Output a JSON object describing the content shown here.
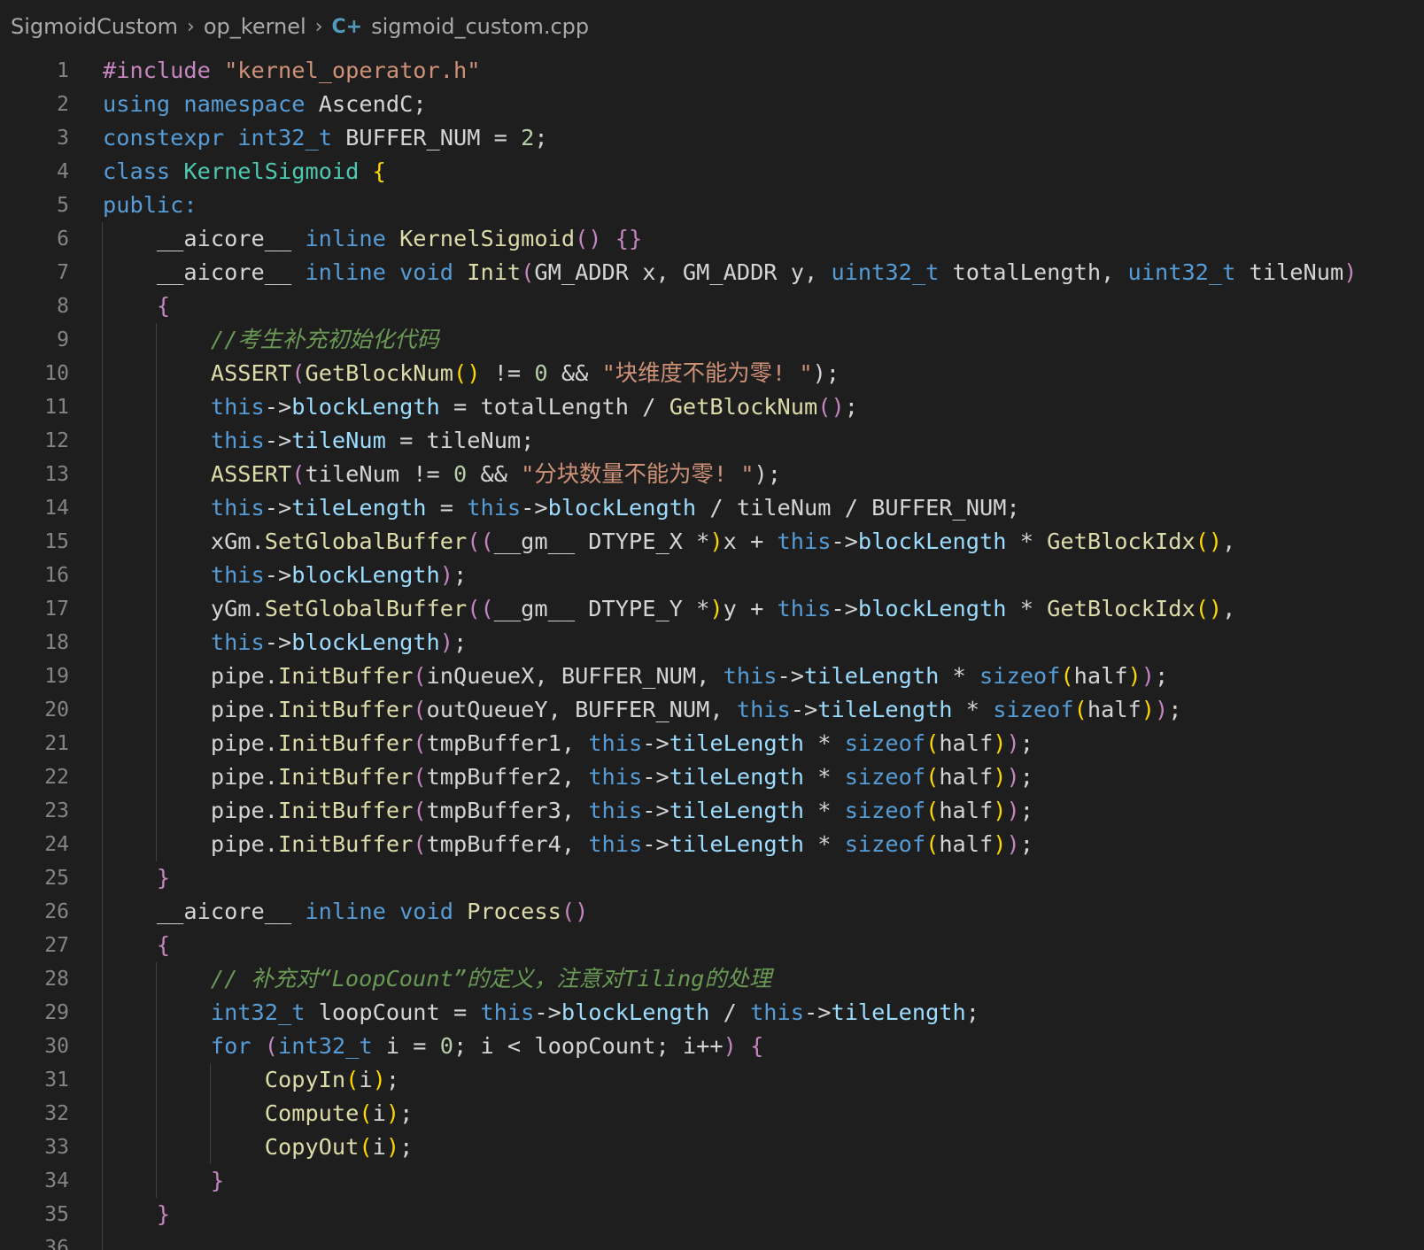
{
  "breadcrumb": {
    "items": [
      "SigmoidCustom",
      "op_kernel",
      "sigmoid_custom.cpp"
    ],
    "file_icon": "cpp-file-icon"
  },
  "colors": {
    "background": "#1e1e1e",
    "text": "#d4d4d4",
    "line_number": "#858585",
    "keyword": "#569cd6",
    "type": "#4ec9b0",
    "string": "#ce9178",
    "function": "#dcdcaa",
    "comment": "#6a9955",
    "number": "#b5cea8",
    "macro": "#c586c0",
    "member": "#9cdcfe"
  },
  "code_lines": [
    [
      [
        "#include ",
        "c"
      ],
      [
        "\"kernel_operator.h\"",
        "s"
      ]
    ],
    [
      [
        "using ",
        "k"
      ],
      [
        "namespace ",
        "k"
      ],
      [
        "AscendC;",
        "d"
      ]
    ],
    [
      [
        "constexpr ",
        "k"
      ],
      [
        "int32_t ",
        "k"
      ],
      [
        "BUFFER_NUM = ",
        "d"
      ],
      [
        "2",
        "n"
      ],
      [
        ";",
        "d"
      ]
    ],
    [
      [
        "class ",
        "k"
      ],
      [
        "KernelSigmoid ",
        "t"
      ],
      [
        "{",
        "y"
      ]
    ],
    [
      [
        "public:",
        "k"
      ]
    ],
    [
      [
        "    ",
        "d"
      ],
      [
        "__aicore__ ",
        "d"
      ],
      [
        "inline ",
        "k"
      ],
      [
        "KernelSigmoid",
        "f"
      ],
      [
        "() ",
        "p"
      ],
      [
        "{}",
        "p"
      ]
    ],
    [
      [
        "    ",
        "d"
      ],
      [
        "__aicore__ ",
        "d"
      ],
      [
        "inline ",
        "k"
      ],
      [
        "void ",
        "k"
      ],
      [
        "Init",
        "f"
      ],
      [
        "(",
        "p"
      ],
      [
        "GM_ADDR x, GM_ADDR y, ",
        "d"
      ],
      [
        "uint32_t ",
        "k"
      ],
      [
        "totalLength, ",
        "d"
      ],
      [
        "uint32_t ",
        "k"
      ],
      [
        "tileNum",
        "d"
      ],
      [
        ")",
        "p"
      ]
    ],
    [
      [
        "    ",
        "d"
      ],
      [
        "{",
        "p"
      ]
    ],
    [
      [
        "        ",
        "d"
      ],
      [
        "//考生补充初始化代码",
        "m"
      ]
    ],
    [
      [
        "        ",
        "d"
      ],
      [
        "ASSERT",
        "f"
      ],
      [
        "(",
        "p"
      ],
      [
        "GetBlockNum",
        "f"
      ],
      [
        "() ",
        "y"
      ],
      [
        "!= ",
        "d"
      ],
      [
        "0 ",
        "n"
      ],
      [
        "&& ",
        "d"
      ],
      [
        "\"块维度不能为零! \"",
        "s"
      ],
      [
        ");",
        "d"
      ]
    ],
    [
      [
        "        ",
        "d"
      ],
      [
        "this",
        "k"
      ],
      [
        "->",
        "d"
      ],
      [
        "blockLength ",
        "b"
      ],
      [
        "= totalLength / ",
        "d"
      ],
      [
        "GetBlockNum",
        "f"
      ],
      [
        "()",
        "p"
      ],
      [
        ";",
        "d"
      ]
    ],
    [
      [
        "        ",
        "d"
      ],
      [
        "this",
        "k"
      ],
      [
        "->",
        "d"
      ],
      [
        "tileNum ",
        "b"
      ],
      [
        "= tileNum;",
        "d"
      ]
    ],
    [
      [
        "        ",
        "d"
      ],
      [
        "ASSERT",
        "f"
      ],
      [
        "(",
        "p"
      ],
      [
        "tileNum != ",
        "d"
      ],
      [
        "0 ",
        "n"
      ],
      [
        "&& ",
        "d"
      ],
      [
        "\"分块数量不能为零! \"",
        "s"
      ],
      [
        ");",
        "d"
      ]
    ],
    [
      [
        "        ",
        "d"
      ],
      [
        "this",
        "k"
      ],
      [
        "->",
        "d"
      ],
      [
        "tileLength ",
        "b"
      ],
      [
        "= ",
        "d"
      ],
      [
        "this",
        "k"
      ],
      [
        "->",
        "d"
      ],
      [
        "blockLength ",
        "b"
      ],
      [
        "/ tileNum / BUFFER_NUM;",
        "d"
      ]
    ],
    [
      [
        "        ",
        "d"
      ],
      [
        "xGm.",
        "d"
      ],
      [
        "SetGlobalBuffer",
        "f"
      ],
      [
        "((",
        "p"
      ],
      [
        "__gm__ DTYPE_X *",
        "d"
      ],
      [
        ")",
        "y"
      ],
      [
        "x + ",
        "d"
      ],
      [
        "this",
        "k"
      ],
      [
        "->",
        "d"
      ],
      [
        "blockLength ",
        "b"
      ],
      [
        "* ",
        "d"
      ],
      [
        "GetBlockIdx",
        "f"
      ],
      [
        "()",
        "y"
      ],
      [
        ",",
        "d"
      ]
    ],
    [
      [
        "        ",
        "d"
      ],
      [
        "this",
        "k"
      ],
      [
        "->",
        "d"
      ],
      [
        "blockLength",
        "b"
      ],
      [
        ")",
        "p"
      ],
      [
        ";",
        "d"
      ]
    ],
    [
      [
        "        ",
        "d"
      ],
      [
        "yGm.",
        "d"
      ],
      [
        "SetGlobalBuffer",
        "f"
      ],
      [
        "((",
        "p"
      ],
      [
        "__gm__ DTYPE_Y *",
        "d"
      ],
      [
        ")",
        "y"
      ],
      [
        "y + ",
        "d"
      ],
      [
        "this",
        "k"
      ],
      [
        "->",
        "d"
      ],
      [
        "blockLength ",
        "b"
      ],
      [
        "* ",
        "d"
      ],
      [
        "GetBlockIdx",
        "f"
      ],
      [
        "()",
        "y"
      ],
      [
        ",",
        "d"
      ]
    ],
    [
      [
        "        ",
        "d"
      ],
      [
        "this",
        "k"
      ],
      [
        "->",
        "d"
      ],
      [
        "blockLength",
        "b"
      ],
      [
        ")",
        "p"
      ],
      [
        ";",
        "d"
      ]
    ],
    [
      [
        "        ",
        "d"
      ],
      [
        "pipe.",
        "d"
      ],
      [
        "InitBuffer",
        "f"
      ],
      [
        "(",
        "p"
      ],
      [
        "inQueueX, BUFFER_NUM, ",
        "d"
      ],
      [
        "this",
        "k"
      ],
      [
        "->",
        "d"
      ],
      [
        "tileLength ",
        "b"
      ],
      [
        "* ",
        "d"
      ],
      [
        "sizeof",
        "k"
      ],
      [
        "(",
        "y"
      ],
      [
        "half",
        "d"
      ],
      [
        ")",
        "y"
      ],
      [
        ")",
        "p"
      ],
      [
        ";",
        "d"
      ]
    ],
    [
      [
        "        ",
        "d"
      ],
      [
        "pipe.",
        "d"
      ],
      [
        "InitBuffer",
        "f"
      ],
      [
        "(",
        "p"
      ],
      [
        "outQueueY, BUFFER_NUM, ",
        "d"
      ],
      [
        "this",
        "k"
      ],
      [
        "->",
        "d"
      ],
      [
        "tileLength ",
        "b"
      ],
      [
        "* ",
        "d"
      ],
      [
        "sizeof",
        "k"
      ],
      [
        "(",
        "y"
      ],
      [
        "half",
        "d"
      ],
      [
        ")",
        "y"
      ],
      [
        ")",
        "p"
      ],
      [
        ";",
        "d"
      ]
    ],
    [
      [
        "        ",
        "d"
      ],
      [
        "pipe.",
        "d"
      ],
      [
        "InitBuffer",
        "f"
      ],
      [
        "(",
        "p"
      ],
      [
        "tmpBuffer1, ",
        "d"
      ],
      [
        "this",
        "k"
      ],
      [
        "->",
        "d"
      ],
      [
        "tileLength ",
        "b"
      ],
      [
        "* ",
        "d"
      ],
      [
        "sizeof",
        "k"
      ],
      [
        "(",
        "y"
      ],
      [
        "half",
        "d"
      ],
      [
        ")",
        "y"
      ],
      [
        ")",
        "p"
      ],
      [
        ";",
        "d"
      ]
    ],
    [
      [
        "        ",
        "d"
      ],
      [
        "pipe.",
        "d"
      ],
      [
        "InitBuffer",
        "f"
      ],
      [
        "(",
        "p"
      ],
      [
        "tmpBuffer2, ",
        "d"
      ],
      [
        "this",
        "k"
      ],
      [
        "->",
        "d"
      ],
      [
        "tileLength ",
        "b"
      ],
      [
        "* ",
        "d"
      ],
      [
        "sizeof",
        "k"
      ],
      [
        "(",
        "y"
      ],
      [
        "half",
        "d"
      ],
      [
        ")",
        "y"
      ],
      [
        ")",
        "p"
      ],
      [
        ";",
        "d"
      ]
    ],
    [
      [
        "        ",
        "d"
      ],
      [
        "pipe.",
        "d"
      ],
      [
        "InitBuffer",
        "f"
      ],
      [
        "(",
        "p"
      ],
      [
        "tmpBuffer3, ",
        "d"
      ],
      [
        "this",
        "k"
      ],
      [
        "->",
        "d"
      ],
      [
        "tileLength ",
        "b"
      ],
      [
        "* ",
        "d"
      ],
      [
        "sizeof",
        "k"
      ],
      [
        "(",
        "y"
      ],
      [
        "half",
        "d"
      ],
      [
        ")",
        "y"
      ],
      [
        ")",
        "p"
      ],
      [
        ";",
        "d"
      ]
    ],
    [
      [
        "        ",
        "d"
      ],
      [
        "pipe.",
        "d"
      ],
      [
        "InitBuffer",
        "f"
      ],
      [
        "(",
        "p"
      ],
      [
        "tmpBuffer4, ",
        "d"
      ],
      [
        "this",
        "k"
      ],
      [
        "->",
        "d"
      ],
      [
        "tileLength ",
        "b"
      ],
      [
        "* ",
        "d"
      ],
      [
        "sizeof",
        "k"
      ],
      [
        "(",
        "y"
      ],
      [
        "half",
        "d"
      ],
      [
        ")",
        "y"
      ],
      [
        ")",
        "p"
      ],
      [
        ";",
        "d"
      ]
    ],
    [
      [
        "    ",
        "d"
      ],
      [
        "}",
        "p"
      ]
    ],
    [
      [
        "    ",
        "d"
      ],
      [
        "__aicore__ ",
        "d"
      ],
      [
        "inline ",
        "k"
      ],
      [
        "void ",
        "k"
      ],
      [
        "Process",
        "f"
      ],
      [
        "()",
        "p"
      ]
    ],
    [
      [
        "    ",
        "d"
      ],
      [
        "{",
        "p"
      ]
    ],
    [
      [
        "        ",
        "d"
      ],
      [
        "// 补充对“LoopCount”的定义，注意对Tiling的处理",
        "m"
      ]
    ],
    [
      [
        "        ",
        "d"
      ],
      [
        "int32_t ",
        "k"
      ],
      [
        "loopCount = ",
        "d"
      ],
      [
        "this",
        "k"
      ],
      [
        "->",
        "d"
      ],
      [
        "blockLength ",
        "b"
      ],
      [
        "/ ",
        "d"
      ],
      [
        "this",
        "k"
      ],
      [
        "->",
        "d"
      ],
      [
        "tileLength",
        "b"
      ],
      [
        ";",
        "d"
      ]
    ],
    [
      [
        "        ",
        "d"
      ],
      [
        "for ",
        "k"
      ],
      [
        "(",
        "p"
      ],
      [
        "int32_t ",
        "k"
      ],
      [
        "i = ",
        "d"
      ],
      [
        "0",
        "n"
      ],
      [
        "; i < loopCount; i++",
        "d"
      ],
      [
        ") ",
        "p"
      ],
      [
        "{",
        "p"
      ]
    ],
    [
      [
        "            ",
        "d"
      ],
      [
        "CopyIn",
        "f"
      ],
      [
        "(",
        "y"
      ],
      [
        "i",
        "d"
      ],
      [
        ")",
        "y"
      ],
      [
        ";",
        "d"
      ]
    ],
    [
      [
        "            ",
        "d"
      ],
      [
        "Compute",
        "f"
      ],
      [
        "(",
        "y"
      ],
      [
        "i",
        "d"
      ],
      [
        ")",
        "y"
      ],
      [
        ";",
        "d"
      ]
    ],
    [
      [
        "            ",
        "d"
      ],
      [
        "CopyOut",
        "f"
      ],
      [
        "(",
        "y"
      ],
      [
        "i",
        "d"
      ],
      [
        ")",
        "y"
      ],
      [
        ";",
        "d"
      ]
    ],
    [
      [
        "        ",
        "d"
      ],
      [
        "}",
        "p"
      ]
    ],
    [
      [
        "    ",
        "d"
      ],
      [
        "}",
        "p"
      ]
    ],
    [
      [
        "",
        "d"
      ]
    ]
  ]
}
